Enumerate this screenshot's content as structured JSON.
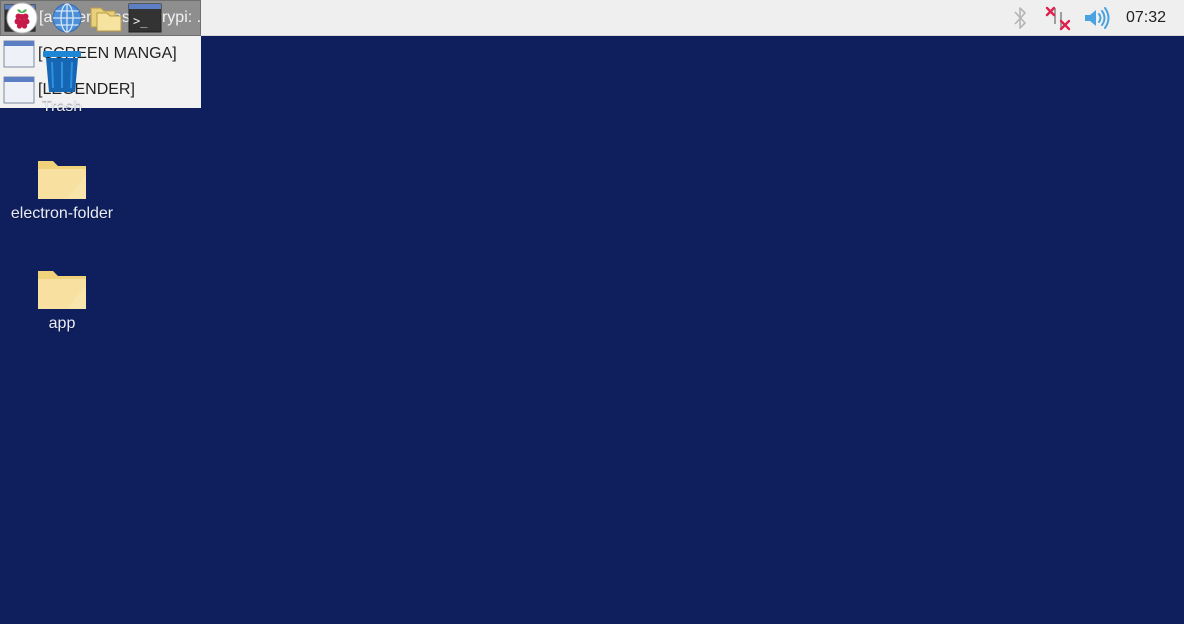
{
  "taskbar": {
    "launchers": [
      {
        "name": "raspberry-menu-icon"
      },
      {
        "name": "web-browser-icon"
      },
      {
        "name": "file-manager-icon"
      },
      {
        "name": "terminal-icon"
      }
    ],
    "tasks": [
      {
        "label": "[avuser@raspberrypi: ...",
        "icon": "terminal-icon",
        "active": true
      },
      {
        "label": "[SCREEN MANGA]",
        "icon": "window-icon",
        "active": false
      },
      {
        "label": "[LEGENDER]",
        "icon": "window-icon",
        "active": false
      }
    ],
    "tray": {
      "bluetooth_icon": "bluetooth-icon",
      "network_icon": "network-disconnected-icon",
      "volume_icon": "volume-icon",
      "clock": "07:32"
    }
  },
  "desktop": {
    "icons": [
      {
        "label": "Trash",
        "icon": "trash-icon"
      },
      {
        "label": "electron-folder",
        "icon": "folder-icon"
      },
      {
        "label": "app",
        "icon": "folder-icon"
      }
    ]
  },
  "colors": {
    "desktop_background": "#0f1f5e",
    "taskbar_background": "#efefef",
    "active_task": "#8e8e8e",
    "folder": "#f5dc8a",
    "trash": "#1a7fd0"
  }
}
